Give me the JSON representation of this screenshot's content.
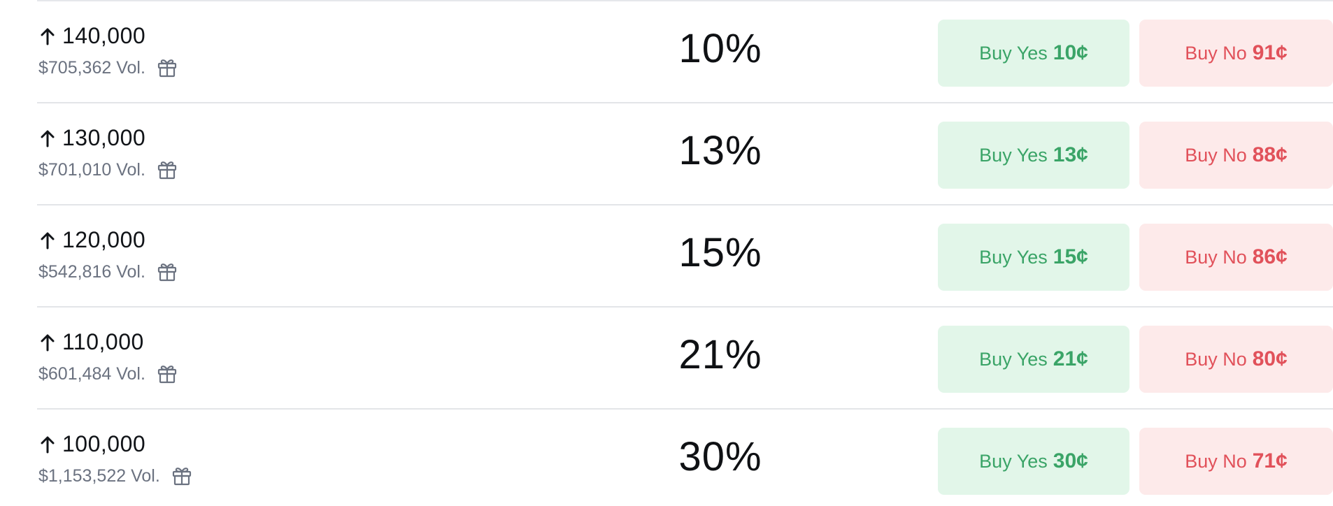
{
  "colors": {
    "yes_bg": "#e2f6e9",
    "yes_text": "#3aa467",
    "no_bg": "#fdeaea",
    "no_text": "#e1515a",
    "divider": "#e3e5e8"
  },
  "icons": {
    "direction": "arrow-up-icon",
    "reward": "gift-icon"
  },
  "markets": [
    {
      "outcome": "140,000",
      "volume": "$705,362 Vol.",
      "chance": "10%",
      "yes_label": "Buy Yes",
      "yes_price": "10¢",
      "no_label": "Buy No",
      "no_price": "91¢"
    },
    {
      "outcome": "130,000",
      "volume": "$701,010 Vol.",
      "chance": "13%",
      "yes_label": "Buy Yes",
      "yes_price": "13¢",
      "no_label": "Buy No",
      "no_price": "88¢"
    },
    {
      "outcome": "120,000",
      "volume": "$542,816 Vol.",
      "chance": "15%",
      "yes_label": "Buy Yes",
      "yes_price": "15¢",
      "no_label": "Buy No",
      "no_price": "86¢"
    },
    {
      "outcome": "110,000",
      "volume": "$601,484 Vol.",
      "chance": "21%",
      "yes_label": "Buy Yes",
      "yes_price": "21¢",
      "no_label": "Buy No",
      "no_price": "80¢"
    },
    {
      "outcome": "100,000",
      "volume": "$1,153,522 Vol.",
      "chance": "30%",
      "yes_label": "Buy Yes",
      "yes_price": "30¢",
      "no_label": "Buy No",
      "no_price": "71¢"
    }
  ]
}
